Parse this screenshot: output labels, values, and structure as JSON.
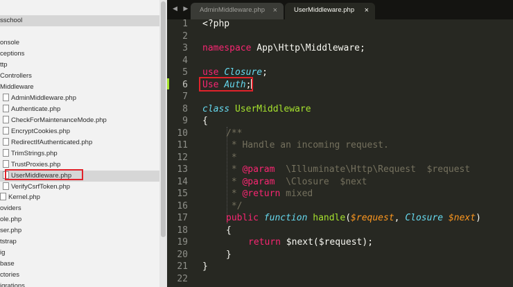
{
  "sidebar": {
    "project": "sschool",
    "items": [
      {
        "label": "onsole",
        "type": "folder"
      },
      {
        "label": "ceptions",
        "type": "folder"
      },
      {
        "label": "ttp",
        "type": "folder"
      },
      {
        "label": "Controllers",
        "type": "folder"
      },
      {
        "label": "Middleware",
        "type": "folder-open"
      },
      {
        "label": "AdminMiddleware.php",
        "type": "file"
      },
      {
        "label": "Authenticate.php",
        "type": "file"
      },
      {
        "label": "CheckForMaintenanceMode.php",
        "type": "file"
      },
      {
        "label": "EncryptCookies.php",
        "type": "file"
      },
      {
        "label": "RedirectIfAuthenticated.php",
        "type": "file"
      },
      {
        "label": "TrimStrings.php",
        "type": "file"
      },
      {
        "label": "TrustProxies.php",
        "type": "file"
      },
      {
        "label": "UserMiddleware.php",
        "type": "file",
        "selected": true
      },
      {
        "label": "VerifyCsrfToken.php",
        "type": "file"
      },
      {
        "label": "Kernel.php",
        "type": "file"
      },
      {
        "label": "oviders",
        "type": "folder"
      },
      {
        "label": "ole.php",
        "type": "file"
      },
      {
        "label": "ser.php",
        "type": "file"
      },
      {
        "label": "tstrap",
        "type": "folder"
      },
      {
        "label": "ig",
        "type": "folder"
      },
      {
        "label": "base",
        "type": "folder"
      },
      {
        "label": "ctories",
        "type": "folder"
      },
      {
        "label": "igrations",
        "type": "folder"
      }
    ]
  },
  "tabs": [
    {
      "label": "AdminMiddleware.php",
      "close": "×",
      "active": false
    },
    {
      "label": "UserMiddleware.php",
      "close": "×",
      "active": true
    }
  ],
  "nav_arrows": "◀ ▶",
  "editor": {
    "line_numbers": [
      "1",
      "2",
      "3",
      "4",
      "5",
      "6",
      "7",
      "8",
      "9",
      "10",
      "11",
      "12",
      "13",
      "14",
      "15",
      "16",
      "17",
      "18",
      "19",
      "20",
      "21",
      "22"
    ],
    "current_line": 6,
    "code": {
      "l1": "<?php",
      "l3_kw": "namespace",
      "l3_rest": " App\\Http\\Middleware;",
      "l5_kw": "use",
      "l5_cls": "Closure",
      "l5_end": ";",
      "l6_kw": "Use",
      "l6_cls": "Auth",
      "l6_end": ";",
      "l8_kw": "class",
      "l8_name": "UserMiddleware",
      "l9": "{",
      "l10": "/**",
      "l11": " * Handle an incoming request.",
      "l12": " *",
      "l13_a": " * ",
      "l13_tag": "@param",
      "l13_b": "  \\Illuminate\\Http\\Request  $request",
      "l14_a": " * ",
      "l14_tag": "@param",
      "l14_b": "  \\Closure  $next",
      "l15_a": " * ",
      "l15_tag": "@return",
      "l15_b": " mixed",
      "l16": " */",
      "l17_kw": "public",
      "l17_fnkw": "function",
      "l17_name": "handle",
      "l17_p1": "$request",
      "l17_type": "Closure",
      "l17_p2": "$next",
      "l18": "{",
      "l19_kw": "return",
      "l19_rest": " $next($request);",
      "l20": "}",
      "l21": "}"
    }
  },
  "colors": {
    "keyword": "#f92672",
    "storage_type": "#66d9ef",
    "function_name": "#a6e22e",
    "comment": "#75715e",
    "parameter": "#fd971f",
    "highlight_box": "#e0232b"
  }
}
